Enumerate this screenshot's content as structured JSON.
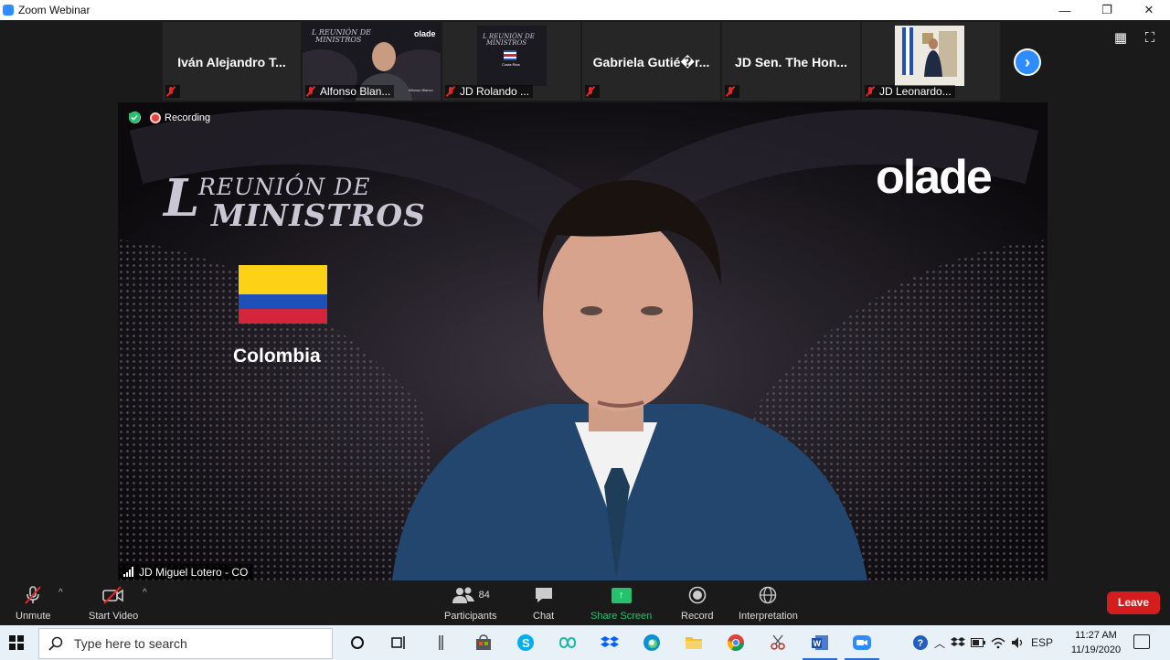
{
  "window": {
    "title": "Zoom Webinar",
    "controls": [
      "—",
      "❐",
      "✕"
    ]
  },
  "gallery": [
    {
      "name_large": "Iván Alejandro T...",
      "label": "",
      "type": "name"
    },
    {
      "name_large": "",
      "label": "Alfonso Blan...",
      "type": "video-person"
    },
    {
      "name_large": "",
      "label": "JD Rolando ...",
      "type": "video-flag"
    },
    {
      "name_large": "Gabriela  Gutié�r...",
      "label": "",
      "type": "name"
    },
    {
      "name_large": "JD Sen. The Hon...",
      "label": "",
      "type": "name"
    },
    {
      "name_large": "",
      "label": "JD Leonardo...",
      "type": "video-office"
    }
  ],
  "main_video": {
    "status": {
      "recording_label": "Recording"
    },
    "event_title": {
      "initial": "L",
      "line1": "REUNIÓN DE",
      "line2": "MINISTROS"
    },
    "brand": "olade",
    "country": "Colombia",
    "speaker_label": "JD Miguel Lotero - CO"
  },
  "toolbar": {
    "unmute": "Unmute",
    "start_video": "Start Video",
    "participants": "Participants",
    "participants_count": "84",
    "chat": "Chat",
    "share_screen": "Share Screen",
    "record": "Record",
    "interpretation": "Interpretation",
    "leave": "Leave",
    "share_color": "#25c16f",
    "leave_color": "#d61d1d"
  },
  "taskbar": {
    "search_placeholder": "Type here to search",
    "language": "ESP",
    "time": "11:27 AM",
    "date": "11/19/2020"
  },
  "colors": {
    "accent": "#2d8cff",
    "flag_yellow": "#fcd116",
    "flag_blue": "#1f4fb8",
    "flag_red": "#d4253a"
  }
}
